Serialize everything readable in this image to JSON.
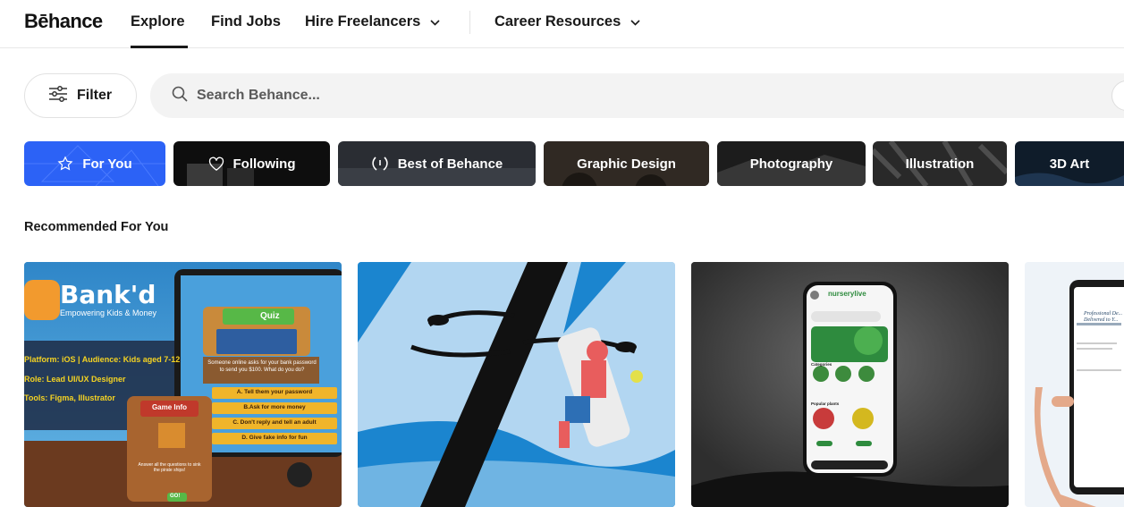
{
  "nav": {
    "logo": "Bēhance",
    "links": [
      {
        "label": "Explore"
      },
      {
        "label": "Find Jobs"
      },
      {
        "label": "Hire Freelancers"
      },
      {
        "label": "Career Resources"
      }
    ]
  },
  "toolbar": {
    "filter_label": "Filter",
    "search_placeholder": "Search Behance..."
  },
  "categories": [
    {
      "label": "For You",
      "icon": "star-icon",
      "color": "#2c62f6"
    },
    {
      "label": "Following",
      "icon": "heart-icon",
      "color": "#0e0e0e"
    },
    {
      "label": "Best of Behance",
      "icon": "laurel-icon",
      "color": "#2a2d33"
    },
    {
      "label": "Graphic Design",
      "icon": "",
      "color": "#3a332c"
    },
    {
      "label": "Photography",
      "icon": "",
      "color": "#2b2b2b"
    },
    {
      "label": "Illustration",
      "icon": "",
      "color": "#3f3f3f"
    },
    {
      "label": "3D Art",
      "icon": "",
      "color": "#0f1c2a"
    }
  ],
  "section": {
    "title": "Recommended For You"
  },
  "cards": {
    "bankd": {
      "logo": "Bank'd",
      "tagline": "Empowering Kids & Money",
      "platform": "Platform: iOS | Audience: Kids aged 7-12",
      "role": "Role: Lead UI/UX Designer",
      "tools": "Tools: Figma, Illustrator",
      "quiz_title": "Quiz",
      "question": "Someone online asks for your bank password to send you $100. What do you do?",
      "answers": [
        "A. Tell them your password",
        "B.Ask for more money",
        "C. Don't reply and tell an adult",
        "D. Give fake info for fun"
      ],
      "game_info": "Game Info",
      "game_sub": "Answer all the questions to sink the pirate ships!",
      "go": "GO!"
    },
    "nursery": {
      "app_name": "nurserylive",
      "categories_label": "Categories",
      "popular_label": "Popular plants"
    },
    "tablet": {
      "heading": "Professional De... Delivered to Y..."
    }
  }
}
